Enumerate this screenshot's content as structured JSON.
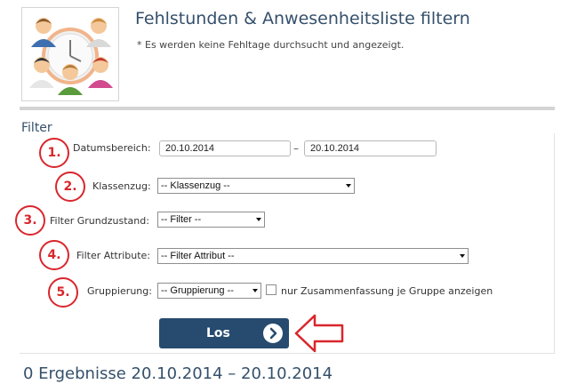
{
  "header": {
    "title": "Fehlstunden & Anwesenheitsliste filtern",
    "note": "* Es werden keine Fehltage durchsucht und angezeigt."
  },
  "filter": {
    "heading": "Filter",
    "steps": [
      "1.",
      "2.",
      "3.",
      "4.",
      "5."
    ],
    "date_range": {
      "label": "Datumsbereich:",
      "from": "20.10.2014",
      "separator": "–",
      "to": "20.10.2014"
    },
    "klassenzug": {
      "label": "Klassenzug:",
      "selected": "-- Klassenzug --"
    },
    "grundzustand": {
      "label": "Filter Grundzustand:",
      "selected": "-- Filter --"
    },
    "attribute": {
      "label": "Filter Attribute:",
      "selected": "-- Filter Attribut --"
    },
    "gruppierung": {
      "label": "Gruppierung:",
      "selected": "-- Gruppierung --",
      "checkbox_label": "nur Zusammenfassung je Gruppe anzeigen",
      "checkbox_checked": false
    },
    "submit_label": "Los"
  },
  "results": {
    "title": "0 Ergebnisse 20.10.2014 – 20.10.2014"
  },
  "colors": {
    "accent": "#264b6f",
    "heading": "#35506b",
    "annotation": "#d9262c"
  },
  "icons": {
    "logo": "people-clock-icon",
    "go": "chevron-right-icon",
    "pointer": "arrow-left-icon"
  }
}
